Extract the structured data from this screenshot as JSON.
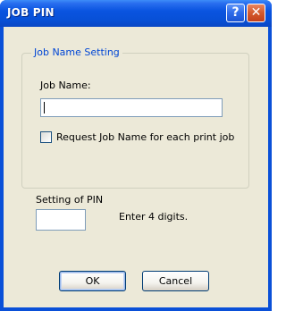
{
  "window": {
    "title": "JOB PIN"
  },
  "title_buttons": {
    "help_glyph": "?",
    "close_glyph": "✕"
  },
  "job_name_group": {
    "legend": "Job Name Setting",
    "job_name_label": "Job Name:",
    "job_name_value": "",
    "request_checkbox_label": "Request Job Name for each print job",
    "request_checked": false
  },
  "pin": {
    "label": "Setting of PIN",
    "value": "",
    "hint": "Enter 4 digits."
  },
  "buttons": {
    "ok": "OK",
    "cancel": "Cancel"
  },
  "colors": {
    "titlebar": "#0a54e0",
    "dialog_face": "#ece9d8",
    "group_legend": "#0046d5",
    "close_button": "#d45a2c"
  }
}
